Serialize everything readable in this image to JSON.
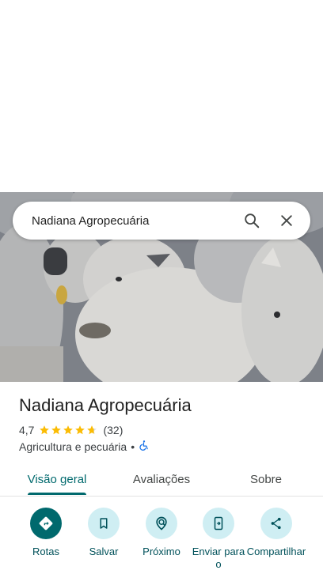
{
  "search": {
    "query": "Nadiana Agropecuária"
  },
  "place": {
    "name": "Nadiana Agropecuária",
    "rating": "4,7",
    "stars": 4.7,
    "review_count": "(32)",
    "category": "Agricultura e pecuária",
    "separator": "•"
  },
  "tabs": [
    {
      "label": "Visão geral",
      "active": true
    },
    {
      "label": "Avaliações",
      "active": false
    },
    {
      "label": "Sobre",
      "active": false
    }
  ],
  "actions": [
    {
      "label": "Rotas",
      "icon": "directions-icon"
    },
    {
      "label": "Salvar",
      "icon": "bookmark-icon"
    },
    {
      "label": "Próximo",
      "icon": "nearby-icon"
    },
    {
      "label": "Enviar para o",
      "icon": "send-to-phone-icon"
    },
    {
      "label": "Compartilhar",
      "icon": "share-icon"
    }
  ],
  "colors": {
    "accent": "#00696d",
    "action_bg": "#cfeef3",
    "star": "#fbbc04",
    "accessibility": "#1a73e8"
  }
}
